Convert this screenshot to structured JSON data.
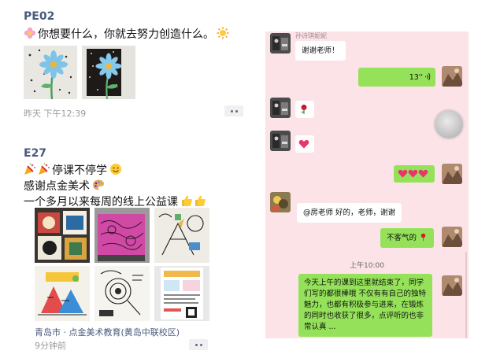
{
  "post1": {
    "username": "PE02",
    "text": "你想要什么，你就去努力创造什么。",
    "lead_emoji": "flower-emoji",
    "tail_emoji": "sun-emoji",
    "timestamp": "昨天 下午12:39"
  },
  "post2": {
    "username": "E27",
    "lines": [
      "停课不停学",
      "感谢点金美术",
      "一个多月以来每周的线上公益课"
    ],
    "lead_emoji": "party-popper-emoji",
    "line1_tail_emoji": "smile-emoji",
    "line2_tail_emoji": "paint-palette-emoji",
    "line3_tail_emoji": "thumbs-up-emoji",
    "location": "青岛市 · 点金美术教育(黄岛中联校区)",
    "timestamp": "9分钟前"
  },
  "chat": {
    "sender_name": "孙诗琪妮妮",
    "msg_thanks": "谢谢老师！",
    "voice_duration": "13''",
    "msg_teacher": "@房老师 好的，老师，谢谢",
    "msg_welcome": "不客气的",
    "time_divider": "上午10:00",
    "msg_long": "今天上午的课到这里就结束了，同学们写的都很棒哦 不仅有有自己的独特魅力，也都有积极参与进来，在锻炼的同时也收获了很多，点评听的也非常认真 ..."
  },
  "colors": {
    "username": "#4a5a7c",
    "chat_bg": "#fbe3e8",
    "bubble_green": "#95e25a",
    "meta_gray": "#9a9a9a"
  }
}
